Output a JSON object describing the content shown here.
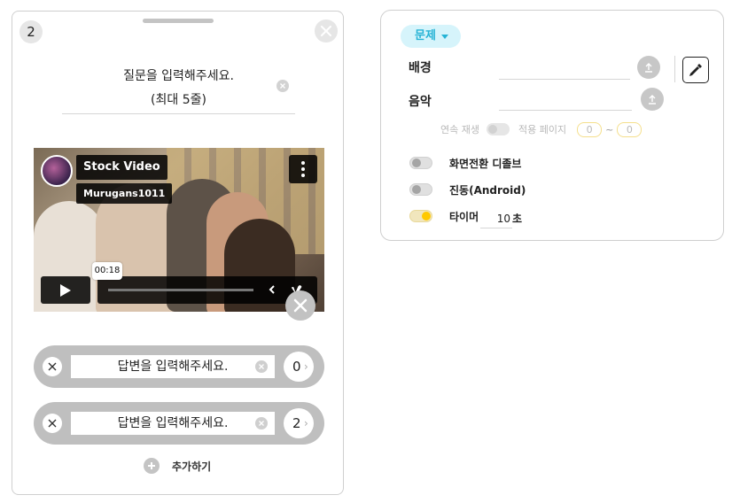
{
  "card": {
    "page_number": "2",
    "question_line1": "질문을 입력해주세요.",
    "question_line2": "(최대 5줄)"
  },
  "video": {
    "title": "Stock Video",
    "channel": "Murugans1011",
    "time": "00:18"
  },
  "answers": [
    {
      "placeholder": "답변을 입력해주세요.",
      "target": "0"
    },
    {
      "placeholder": "답변을 입력해주세요.",
      "target": "2"
    }
  ],
  "add_answer_label": "추가하기",
  "settings": {
    "type_label": "문제",
    "background_label": "배경",
    "music_label": "음악",
    "continuous_play_label": "연속 재생",
    "apply_pages_label": "적용 페이지",
    "page_from": "0",
    "page_to": "0",
    "tilde": "~",
    "transition_label": "화면전환 디졸브",
    "vibration_label": "진동(Android)",
    "timer_label": "타이머",
    "timer_value": "10",
    "timer_unit": "초",
    "toggles": {
      "transition": false,
      "vibration": false,
      "timer": true,
      "continuous_play": false
    }
  },
  "colors": {
    "accent": "#26b3d5",
    "accent_bg": "#d6f4fb",
    "toggle_on": "#ffc900",
    "answer_bg": "#bfbfbf"
  }
}
